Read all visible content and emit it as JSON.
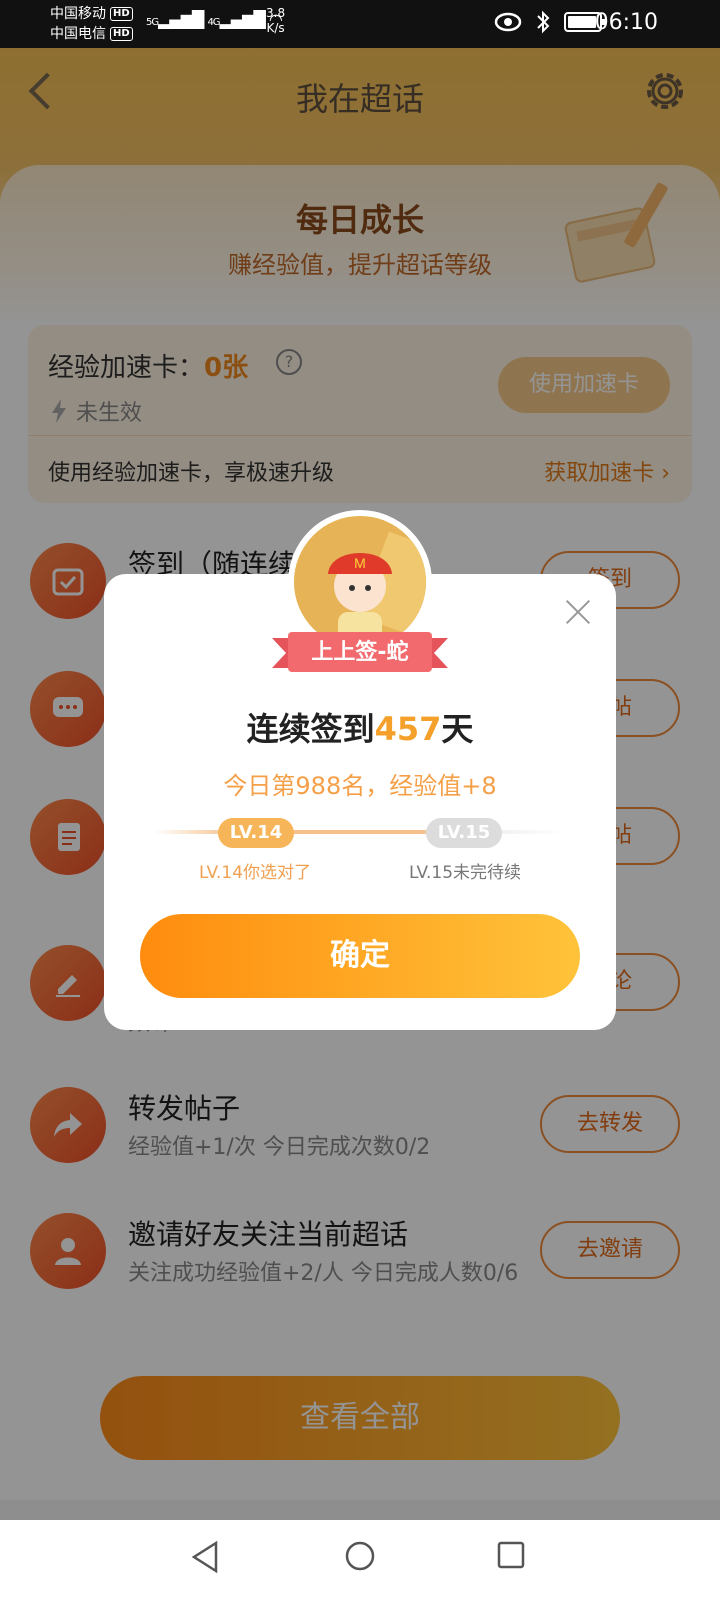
{
  "status_bar": {
    "carrier1": "中国移动",
    "carrier2": "中国电信",
    "hd": "HD",
    "signal1": "5G",
    "signal2": "4G",
    "speed_value": "3.8",
    "speed_unit": "K/s",
    "time": "06:10"
  },
  "header": {
    "title": "我在超话"
  },
  "hero": {
    "title": "每日成长",
    "subtitle": "赚经验值，提升超话等级"
  },
  "boost": {
    "label": "经验加速卡：",
    "count": "0张",
    "help": "?",
    "status": "未生效",
    "use_button": "使用加速卡",
    "note": "使用经验加速卡，享极速升级",
    "get_link": "获取加速卡 ›"
  },
  "tasks": [
    {
      "title": "签到（随连续",
      "sub": "",
      "button": "签到"
    },
    {
      "title": "",
      "sub": "",
      "button": "发帖"
    },
    {
      "title": "",
      "sub": "",
      "button": "看帖"
    },
    {
      "title": "",
      "sub": "数0/4",
      "button": "评论"
    },
    {
      "title": "转发帖子",
      "sub": "经验值+1/次   今日完成次数0/2",
      "button": "去转发"
    },
    {
      "title": "邀请好友关注当前超话",
      "sub": "关注成功经验值+2/人   今日完成人数0/6",
      "button": "去邀请"
    }
  ],
  "view_all": "查看全部",
  "dialog": {
    "badge": "上上签-蛇",
    "streak_prefix": "连续签到",
    "streak_days": "457",
    "streak_suffix": "天",
    "rank_text": "今日第988名，经验值+8",
    "current_level": "LV.14",
    "next_level": "LV.15",
    "current_level_note": "LV.14你选对了",
    "next_level_note": "LV.15未完待续",
    "confirm": "确定",
    "level_progress": 0.65
  },
  "colors": {
    "accent": "#f08a1e",
    "button_gradient_start": "#ff8c0e",
    "button_gradient_end": "#ffc33a",
    "task_icon": "#f0502a"
  },
  "icons": {
    "back": "chevron-left-icon",
    "settings": "gear-icon",
    "lightning": "lightning-icon",
    "close": "close-icon"
  }
}
